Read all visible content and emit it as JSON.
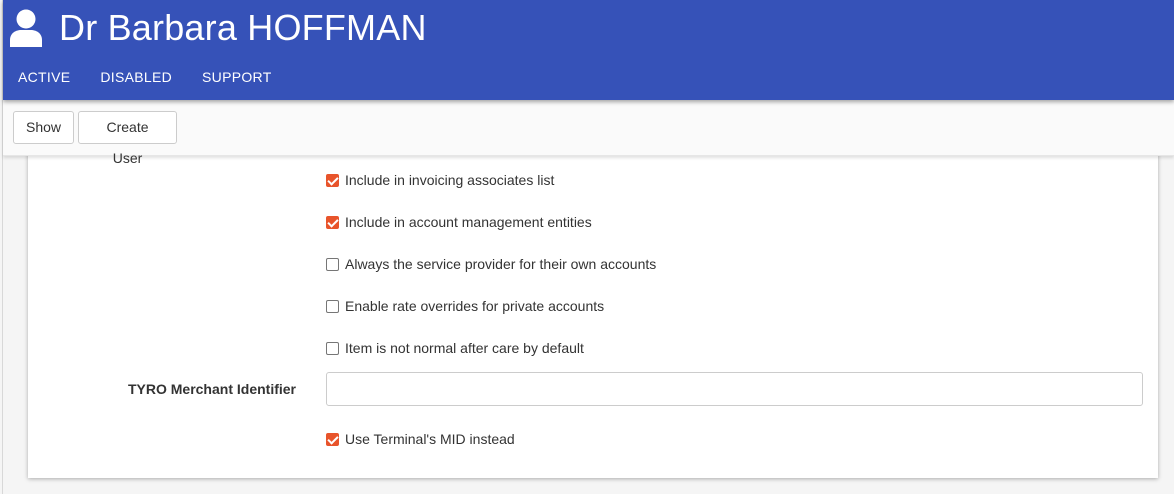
{
  "header": {
    "title": "Dr Barbara HOFFMAN",
    "icon": "user-icon",
    "background_color": "#3652b8",
    "tabs": [
      {
        "label": "ACTIVE"
      },
      {
        "label": "DISABLED"
      },
      {
        "label": "SUPPORT"
      }
    ]
  },
  "toolbar": {
    "show_label": "Show",
    "create_user_label": "Create User"
  },
  "form": {
    "accent_color": "#e8542b",
    "checkboxes": [
      {
        "label": "Include in invoicing associates list",
        "checked": true
      },
      {
        "label": "Include in account management entities",
        "checked": true
      },
      {
        "label": "Always the service provider for their own accounts",
        "checked": false
      },
      {
        "label": "Enable rate overrides for private accounts",
        "checked": false
      },
      {
        "label": "Item is not normal after care by default",
        "checked": false
      }
    ],
    "tyro_label": "TYRO Merchant Identifier",
    "tyro_value": "",
    "tyro_placeholder": "",
    "terminal_mid": {
      "label": "Use Terminal's MID instead",
      "checked": true
    }
  }
}
